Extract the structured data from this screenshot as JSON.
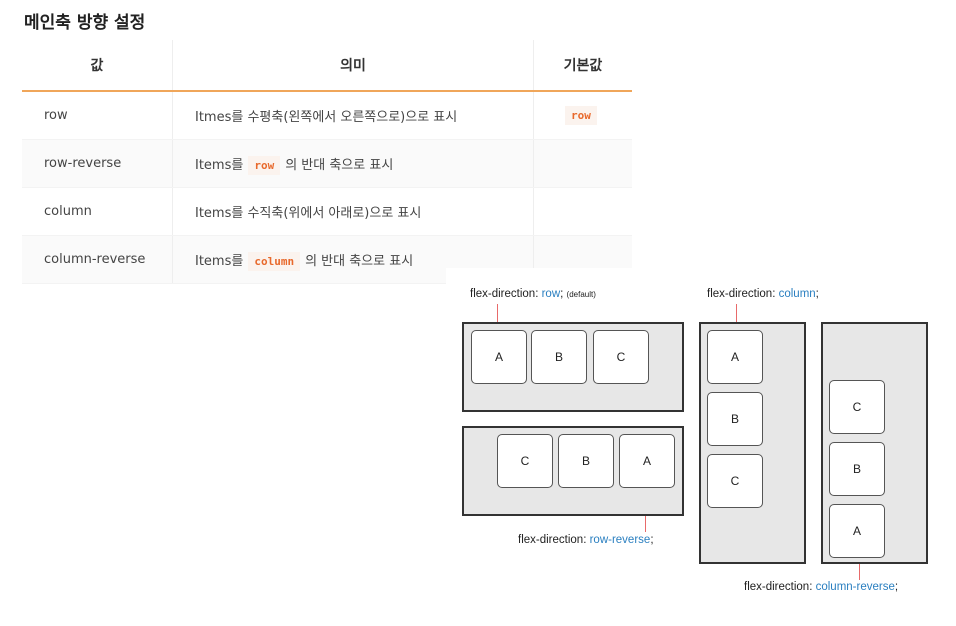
{
  "heading": "메인축 방향 설정",
  "table": {
    "headers": [
      "값",
      "의미",
      "기본값"
    ],
    "rows": [
      {
        "value": "row",
        "meaning_pre": "Itmes를 수평축(왼쪽에서 오른쪽으로)으로 표시",
        "meaning_code": "",
        "meaning_post": "",
        "default": "row"
      },
      {
        "value": "row-reverse",
        "meaning_pre": "Items를",
        "meaning_code": "row",
        "meaning_post": "의 반대 축으로 표시",
        "default": ""
      },
      {
        "value": "column",
        "meaning_pre": "Items를 수직축(위에서 아래로)으로 표시",
        "meaning_code": "",
        "meaning_post": "",
        "default": ""
      },
      {
        "value": "column-reverse",
        "meaning_pre": "Items를",
        "meaning_code": "column",
        "meaning_post": "의 반대 축으로 표시",
        "default": ""
      }
    ]
  },
  "diagram": {
    "prop": "flex-direction:",
    "row_caption": {
      "value": "row",
      "suffix": ";",
      "note": "(default)"
    },
    "column_caption": {
      "value": "column",
      "suffix": ";"
    },
    "row_reverse_caption": {
      "value": "row-reverse",
      "suffix": ";"
    },
    "column_reverse_caption": {
      "value": "column-reverse",
      "suffix": ";"
    },
    "row_items": [
      "A",
      "B",
      "C"
    ],
    "row_reverse_items": [
      "C",
      "B",
      "A"
    ],
    "column_items": [
      "A",
      "B",
      "C"
    ],
    "column_reverse_items": [
      "C",
      "B",
      "A"
    ],
    "value_color": "#2a7fc0",
    "tick_color": "#e86a6a"
  }
}
